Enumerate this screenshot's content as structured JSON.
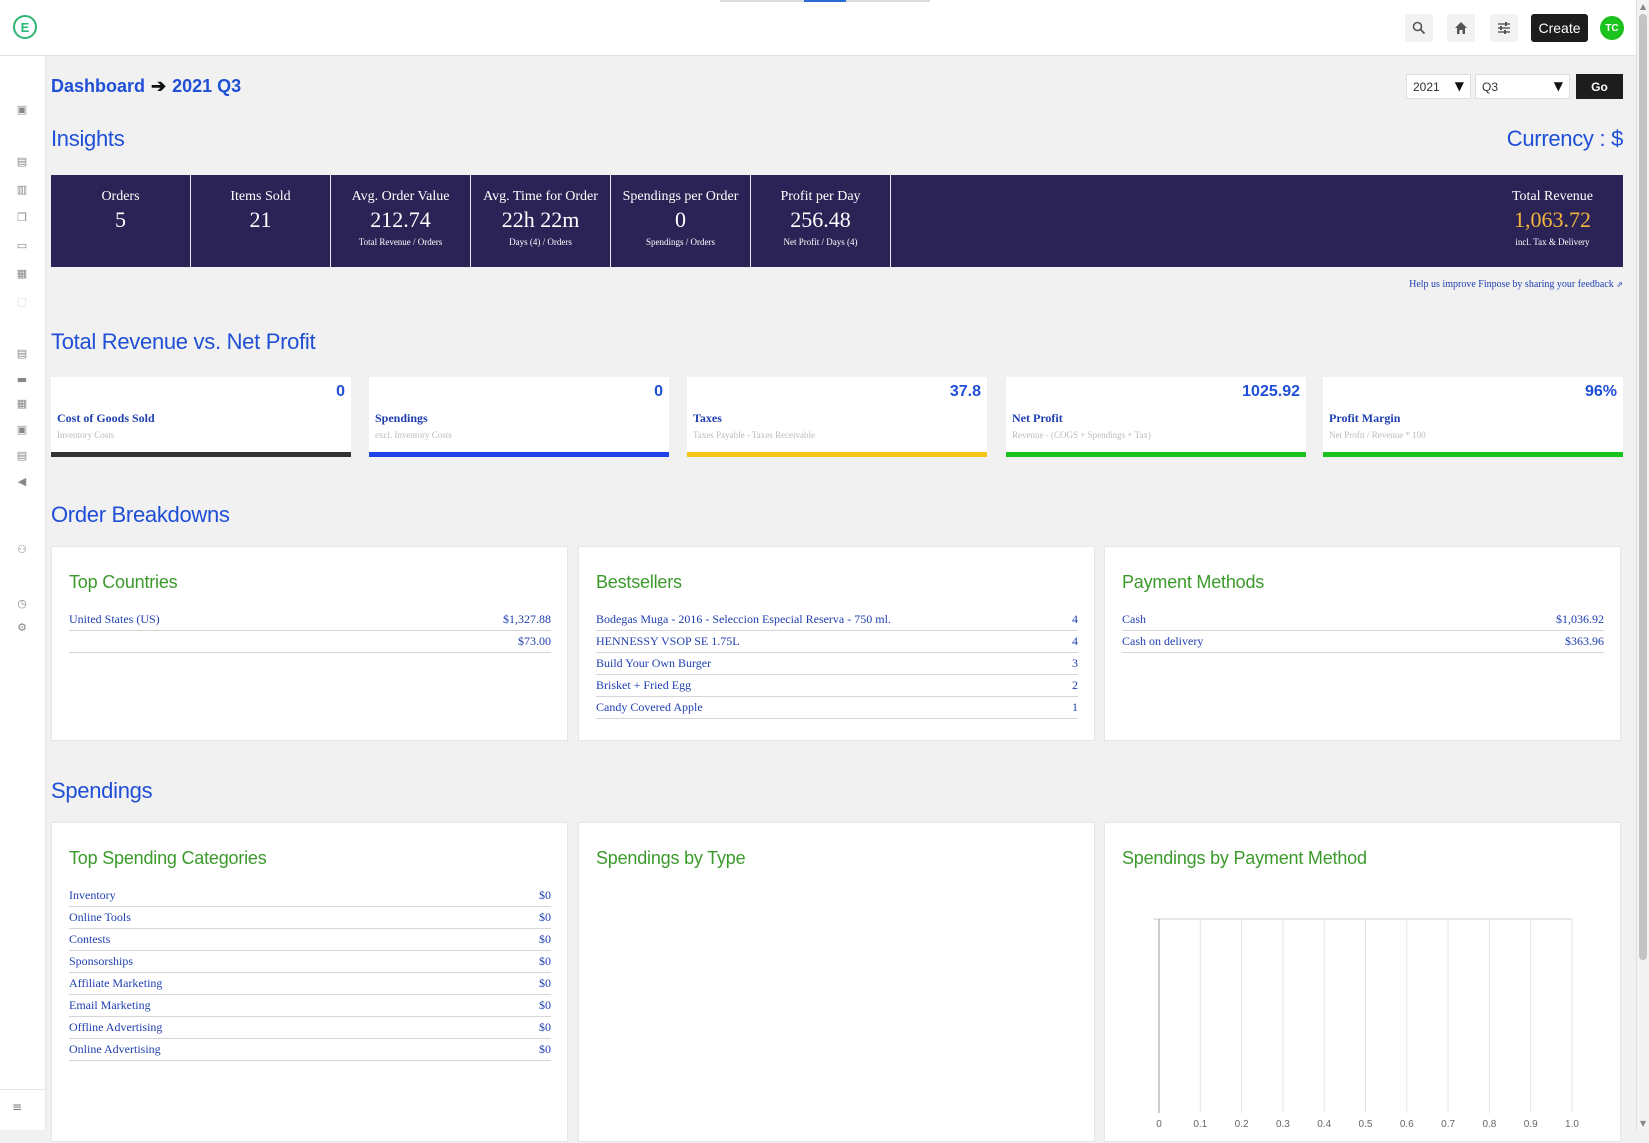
{
  "topbar": {
    "logo_letter": "E",
    "create_label": "Create",
    "avatar_initials": "TC",
    "icons": [
      "search-icon",
      "home-icon",
      "sliders-icon"
    ]
  },
  "sidebar": {
    "icons": [
      "dashboard-icon",
      "folder-icon",
      "document-icon",
      "copy-icon",
      "chat-icon",
      "calendar-icon",
      "image-icon",
      "list-icon",
      "archive-icon",
      "grid-icon",
      "report-icon",
      "ledger-icon",
      "megaphone-icon",
      "users-icon",
      "clock-icon",
      "settings-icon"
    ],
    "collapse_icon": "collapse-icon"
  },
  "header": {
    "breadcrumb_root": "Dashboard",
    "breadcrumb_current": "2021 Q3",
    "year_value": "2021",
    "quarter_value": "Q3",
    "go_label": "Go"
  },
  "insights": {
    "title": "Insights",
    "currency": "Currency : $",
    "cells": [
      {
        "label": "Orders",
        "value": "5",
        "sub": ""
      },
      {
        "label": "Items Sold",
        "value": "21",
        "sub": ""
      },
      {
        "label": "Avg. Order Value",
        "value": "212.74",
        "sub": "Total Revenue / Orders"
      },
      {
        "label": "Avg. Time for Order",
        "value": "22h 22m",
        "sub": "Days (4) / Orders"
      },
      {
        "label": "Spendings per Order",
        "value": "0",
        "sub": "Spendings / Orders"
      },
      {
        "label": "Profit per Day",
        "value": "256.48",
        "sub": "Net Profit / Days (4)"
      }
    ],
    "total": {
      "label": "Total Revenue",
      "value": "1,063.72",
      "sub": "incl. Tax & Delivery"
    },
    "feedback": "Help us improve Finpose by sharing your feedback"
  },
  "revenue_vs_profit": {
    "title": "Total Revenue vs. Net Profit",
    "cards": [
      {
        "value": "0",
        "label": "Cost of Goods Sold",
        "sub": "Inventory Costs",
        "color": "#333333"
      },
      {
        "value": "0",
        "label": "Spendings",
        "sub": "excl. Inventory Costs",
        "color": "#2142e8"
      },
      {
        "value": "37.8",
        "label": "Taxes",
        "sub": "Taxes Payable - Taxes Receivable",
        "color": "#f5c518"
      },
      {
        "value": "1025.92",
        "label": "Net Profit",
        "sub": "Revenue - (COGS + Spendings + Tax)",
        "color": "#19c21c"
      },
      {
        "value": "96%",
        "label": "Profit Margin",
        "sub": "Net Profit / Revenue * 100",
        "color": "#19c21c"
      }
    ]
  },
  "order_breakdowns": {
    "title": "Order Breakdowns",
    "top_countries": {
      "title": "Top Countries",
      "rows": [
        {
          "name": "United States (US)",
          "value": "$1,327.88"
        },
        {
          "name": "",
          "value": "$73.00"
        }
      ]
    },
    "bestsellers": {
      "title": "Bestsellers",
      "rows": [
        {
          "name": "Bodegas Muga - 2016 - Seleccion Especial Reserva - 750 ml.",
          "value": "4"
        },
        {
          "name": "HENNESSY VSOP SE 1.75L",
          "value": "4"
        },
        {
          "name": "Build Your Own Burger",
          "value": "3"
        },
        {
          "name": "Brisket + Fried Egg",
          "value": "2"
        },
        {
          "name": "Candy Covered Apple",
          "value": "1"
        }
      ]
    },
    "payment_methods": {
      "title": "Payment Methods",
      "rows": [
        {
          "name": "Cash",
          "value": "$1,036.92"
        },
        {
          "name": "Cash on delivery",
          "value": "$363.96"
        }
      ]
    }
  },
  "spendings": {
    "title": "Spendings",
    "top_categories": {
      "title": "Top Spending Categories",
      "rows": [
        {
          "name": "Inventory",
          "value": "$0"
        },
        {
          "name": "Online Tools",
          "value": "$0"
        },
        {
          "name": "Contests",
          "value": "$0"
        },
        {
          "name": "Sponsorships",
          "value": "$0"
        },
        {
          "name": "Affiliate Marketing",
          "value": "$0"
        },
        {
          "name": "Email Marketing",
          "value": "$0"
        },
        {
          "name": "Offline Advertising",
          "value": "$0"
        },
        {
          "name": "Online Advertising",
          "value": "$0"
        }
      ]
    },
    "by_type": {
      "title": "Spendings by Type"
    },
    "by_payment": {
      "title": "Spendings by Payment Method"
    }
  },
  "chart_data": {
    "type": "bar",
    "title": "Spendings by Payment Method",
    "xlabel": "",
    "ylabel": "",
    "xlim": [
      0,
      1.0
    ],
    "x_ticks": [
      "0",
      "0.1",
      "0.2",
      "0.3",
      "0.4",
      "0.5",
      "0.6",
      "0.7",
      "0.8",
      "0.9",
      "1.0"
    ],
    "categories": [],
    "values": [],
    "grid": true
  }
}
